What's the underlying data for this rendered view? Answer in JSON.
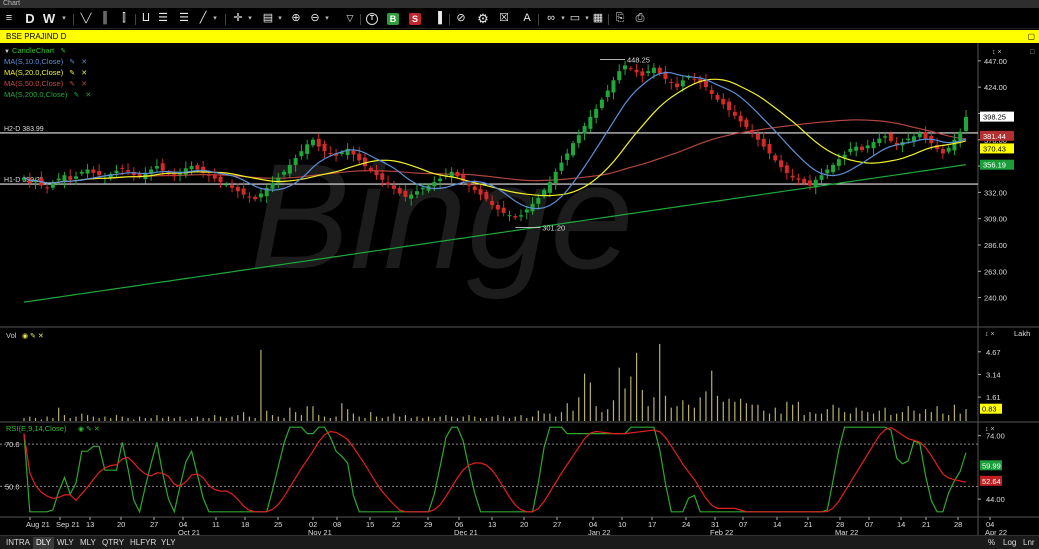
{
  "window": {
    "title": "Chart"
  },
  "toolbar": {
    "items": [
      {
        "name": "menu-icon",
        "glyph": "≡"
      },
      {
        "name": "day-letter",
        "glyph": "D"
      },
      {
        "name": "week-letter",
        "glyph": "W"
      },
      {
        "name": "period-caret",
        "glyph": "▾"
      },
      {
        "name": "line-chart-icon",
        "glyph": "╲╱"
      },
      {
        "name": "bar-chart-icon",
        "glyph": "║"
      },
      {
        "name": "candle-icon",
        "glyph": "⫿"
      },
      {
        "name": "indicators-icon",
        "glyph": "⨿"
      },
      {
        "name": "list-icon",
        "glyph": "☰"
      },
      {
        "name": "draw-tool-icon",
        "glyph": "╱"
      },
      {
        "name": "crosshair-icon",
        "glyph": "✛"
      },
      {
        "name": "layout-icon",
        "glyph": "▤"
      },
      {
        "name": "zoom-in-icon",
        "glyph": "⊕"
      },
      {
        "name": "zoom-out-icon",
        "glyph": "⊖"
      },
      {
        "name": "filter-icon",
        "glyph": "▽"
      },
      {
        "name": "trade-t-icon",
        "glyph": "T"
      },
      {
        "name": "buy-icon",
        "glyph": "B"
      },
      {
        "name": "sell-icon",
        "glyph": "S"
      },
      {
        "name": "volume-bars-icon",
        "glyph": "▐"
      },
      {
        "name": "hide-icon",
        "glyph": "⊘"
      },
      {
        "name": "settings-gear-icon",
        "glyph": "⚙"
      },
      {
        "name": "delete-icon",
        "glyph": "☒"
      },
      {
        "name": "text-tool-icon",
        "glyph": "A"
      },
      {
        "name": "link-icon",
        "glyph": "∞"
      },
      {
        "name": "window-icon",
        "glyph": "▭"
      },
      {
        "name": "grid-icon",
        "glyph": "▦"
      },
      {
        "name": "export-icon",
        "glyph": "⎘"
      },
      {
        "name": "print-icon",
        "glyph": "⎙"
      }
    ]
  },
  "symbol": {
    "label": "BSE PRAJIND D",
    "maximize": "▢"
  },
  "legend": {
    "candle": "CandleChart",
    "ma10": "MA(S,10.0,Close)",
    "ma20": "MA(S,20.0,Close)",
    "ma50": "MA(S,50.0,Close)",
    "ma200": "MA(S,200.0,Close)"
  },
  "hlines": {
    "h2": "H2-D 383.99",
    "h1": "H1-D 339.25"
  },
  "annotations": {
    "high": "448.25",
    "low": "301.20"
  },
  "watermark": "Binge",
  "price_axis": {
    "ticks": [
      "447.00",
      "424.00",
      "401.00",
      "378.00",
      "355.00",
      "332.00",
      "309.00",
      "286.00",
      "263.00",
      "240.00"
    ],
    "badges": [
      {
        "label": "398.25",
        "bg": "#ffffff",
        "fg": "#000000"
      },
      {
        "label": "381.44",
        "bg": "#b23030",
        "fg": "#ffffff"
      },
      {
        "label": "370.43",
        "bg": "#ffff00",
        "fg": "#000000"
      },
      {
        "label": "356.19",
        "bg": "#1a9e3a",
        "fg": "#ffffff"
      }
    ]
  },
  "volume": {
    "label": "Vol",
    "unit": "Lakh",
    "ticks": [
      "4.67",
      "3.14",
      "1.61"
    ],
    "badge": "0.83"
  },
  "rsi": {
    "label": "RSI(E,9,14,Close)",
    "level_high": "70.0",
    "level_low": "50.0",
    "ticks": [
      "74.00",
      "44.00"
    ],
    "badge_rsi": "59.99",
    "badge_sig": "52.64"
  },
  "xaxis": {
    "labels": [
      {
        "text": "Aug 21",
        "sub": ""
      },
      {
        "text": "Sep 21",
        "sub": ""
      },
      {
        "text": "13",
        "sub": ""
      },
      {
        "text": "20",
        "sub": ""
      },
      {
        "text": "27",
        "sub": ""
      },
      {
        "text": "04",
        "sub": "Oct 21"
      },
      {
        "text": "11",
        "sub": ""
      },
      {
        "text": "18",
        "sub": ""
      },
      {
        "text": "25",
        "sub": ""
      },
      {
        "text": "02",
        "sub": "Nov 21"
      },
      {
        "text": "08",
        "sub": ""
      },
      {
        "text": "15",
        "sub": ""
      },
      {
        "text": "22",
        "sub": ""
      },
      {
        "text": "29",
        "sub": ""
      },
      {
        "text": "06",
        "sub": "Dec 21"
      },
      {
        "text": "13",
        "sub": ""
      },
      {
        "text": "20",
        "sub": ""
      },
      {
        "text": "27",
        "sub": ""
      },
      {
        "text": "04",
        "sub": "Jan 22"
      },
      {
        "text": "10",
        "sub": ""
      },
      {
        "text": "17",
        "sub": ""
      },
      {
        "text": "24",
        "sub": ""
      },
      {
        "text": "31",
        "sub": "Feb 22"
      },
      {
        "text": "07",
        "sub": ""
      },
      {
        "text": "14",
        "sub": ""
      },
      {
        "text": "21",
        "sub": ""
      },
      {
        "text": "28",
        "sub": "Mar 22"
      },
      {
        "text": "07",
        "sub": ""
      },
      {
        "text": "14",
        "sub": ""
      },
      {
        "text": "21",
        "sub": ""
      },
      {
        "text": "28",
        "sub": ""
      },
      {
        "text": "04",
        "sub": "Apr 22"
      }
    ]
  },
  "bottom": {
    "tabs": [
      "INTRA",
      "DLY",
      "WLY",
      "MLY",
      "QTRY",
      "HLFYR",
      "YLY"
    ],
    "active_tab": "DLY",
    "right": [
      "%",
      "Log",
      "Lnr"
    ]
  },
  "colors": {
    "up": "#1fa83a",
    "down": "#d42a2a",
    "ma10": "#5b8fd6",
    "ma20": "#f2f22a",
    "ma50": "#b0453d",
    "ma200": "#1fa83a",
    "volume": "#b8b068",
    "rsi": "#2fa82f",
    "rsi_signal": "#e02020"
  },
  "chart_data": {
    "type": "candlestick",
    "symbol": "BSE PRAJIND D",
    "key_levels": {
      "high": 448.25,
      "low": 301.2,
      "H2": 383.99,
      "H1": 339.25
    },
    "last": {
      "close": 398.25,
      "ma50": 381.44,
      "ma20": 370.43,
      "ma200": 356.19
    },
    "closes": [
      345,
      340,
      342,
      338,
      336,
      341,
      344,
      347,
      343,
      346,
      350,
      352,
      349,
      347,
      345,
      348,
      351,
      353,
      350,
      347,
      346,
      349,
      352,
      355,
      351,
      348,
      346,
      350,
      353,
      355,
      352,
      349,
      347,
      344,
      341,
      339,
      336,
      333,
      330,
      328,
      326,
      331,
      336,
      340,
      345,
      350,
      356,
      362,
      368,
      374,
      378,
      372,
      368,
      366,
      364,
      367,
      370,
      365,
      360,
      355,
      351,
      347,
      343,
      339,
      335,
      331,
      328,
      330,
      333,
      336,
      338,
      341,
      344,
      347,
      350,
      346,
      342,
      338,
      334,
      330,
      326,
      321,
      317,
      314,
      312,
      310,
      312,
      317,
      322,
      327,
      334,
      341,
      350,
      358,
      366,
      375,
      382,
      390,
      398,
      405,
      413,
      421,
      430,
      438,
      443,
      440,
      437,
      434,
      438,
      441,
      436,
      431,
      428,
      424,
      430,
      433,
      431,
      428,
      424,
      418,
      413,
      409,
      404,
      399,
      394,
      389,
      384,
      378,
      372,
      366,
      360,
      354,
      349,
      345,
      343,
      340,
      338,
      343,
      347,
      352,
      356,
      361,
      365,
      370,
      372,
      369,
      373,
      376,
      379,
      381,
      377,
      373,
      376,
      379,
      381,
      384,
      379,
      375,
      370,
      366,
      371,
      378,
      385,
      398
    ],
    "volume_lakh": [
      0.2,
      0.3,
      0.2,
      0.1,
      0.3,
      0.2,
      0.9,
      0.4,
      0.2,
      0.3,
      0.5,
      0.4,
      0.3,
      0.2,
      0.3,
      0.2,
      0.4,
      0.3,
      0.2,
      0.1,
      0.3,
      0.2,
      0.2,
      0.4,
      0.2,
      0.3,
      0.2,
      0.3,
      0.1,
      0.2,
      0.3,
      0.2,
      0.2,
      0.4,
      0.3,
      0.2,
      0.3,
      0.4,
      0.6,
      0.3,
      0.2,
      4.8,
      0.7,
      0.4,
      0.3,
      0.2,
      0.9,
      0.6,
      0.4,
      1.0,
      1.0,
      0.4,
      0.3,
      0.2,
      0.3,
      1.2,
      0.8,
      0.5,
      0.3,
      0.2,
      0.6,
      0.3,
      0.2,
      0.3,
      0.5,
      0.3,
      0.4,
      0.2,
      0.3,
      0.2,
      0.3,
      0.2,
      0.3,
      0.4,
      0.3,
      0.2,
      0.3,
      0.4,
      0.3,
      0.2,
      0.2,
      0.3,
      0.4,
      0.3,
      0.2,
      0.3,
      0.4,
      0.2,
      0.3,
      0.7,
      0.5,
      0.5,
      0.3,
      0.6,
      1.2,
      0.7,
      1.6,
      3.2,
      2.6,
      1.0,
      0.6,
      0.8,
      1.4,
      3.6,
      2.2,
      3.0,
      4.6,
      2.1,
      1.0,
      1.6,
      5.2,
      1.7,
      0.9,
      1.0,
      1.4,
      1.1,
      0.9,
      1.6,
      2.0,
      3.4,
      1.7,
      1.3,
      1.5,
      1.3,
      1.5,
      1.2,
      1.1,
      1.1,
      0.7,
      0.5,
      0.9,
      0.5,
      1.3,
      1.1,
      1.3,
      0.4,
      0.6,
      0.5,
      0.5,
      0.8,
      1.1,
      0.9,
      0.6,
      0.5,
      0.9,
      0.7,
      0.6,
      0.5,
      0.7,
      0.9,
      0.4,
      0.5,
      0.6,
      1.0,
      0.7,
      0.5,
      0.8,
      0.6,
      1.0,
      0.5,
      0.4,
      1.1,
      0.5,
      0.8,
      0.6,
      0.5
    ]
  }
}
